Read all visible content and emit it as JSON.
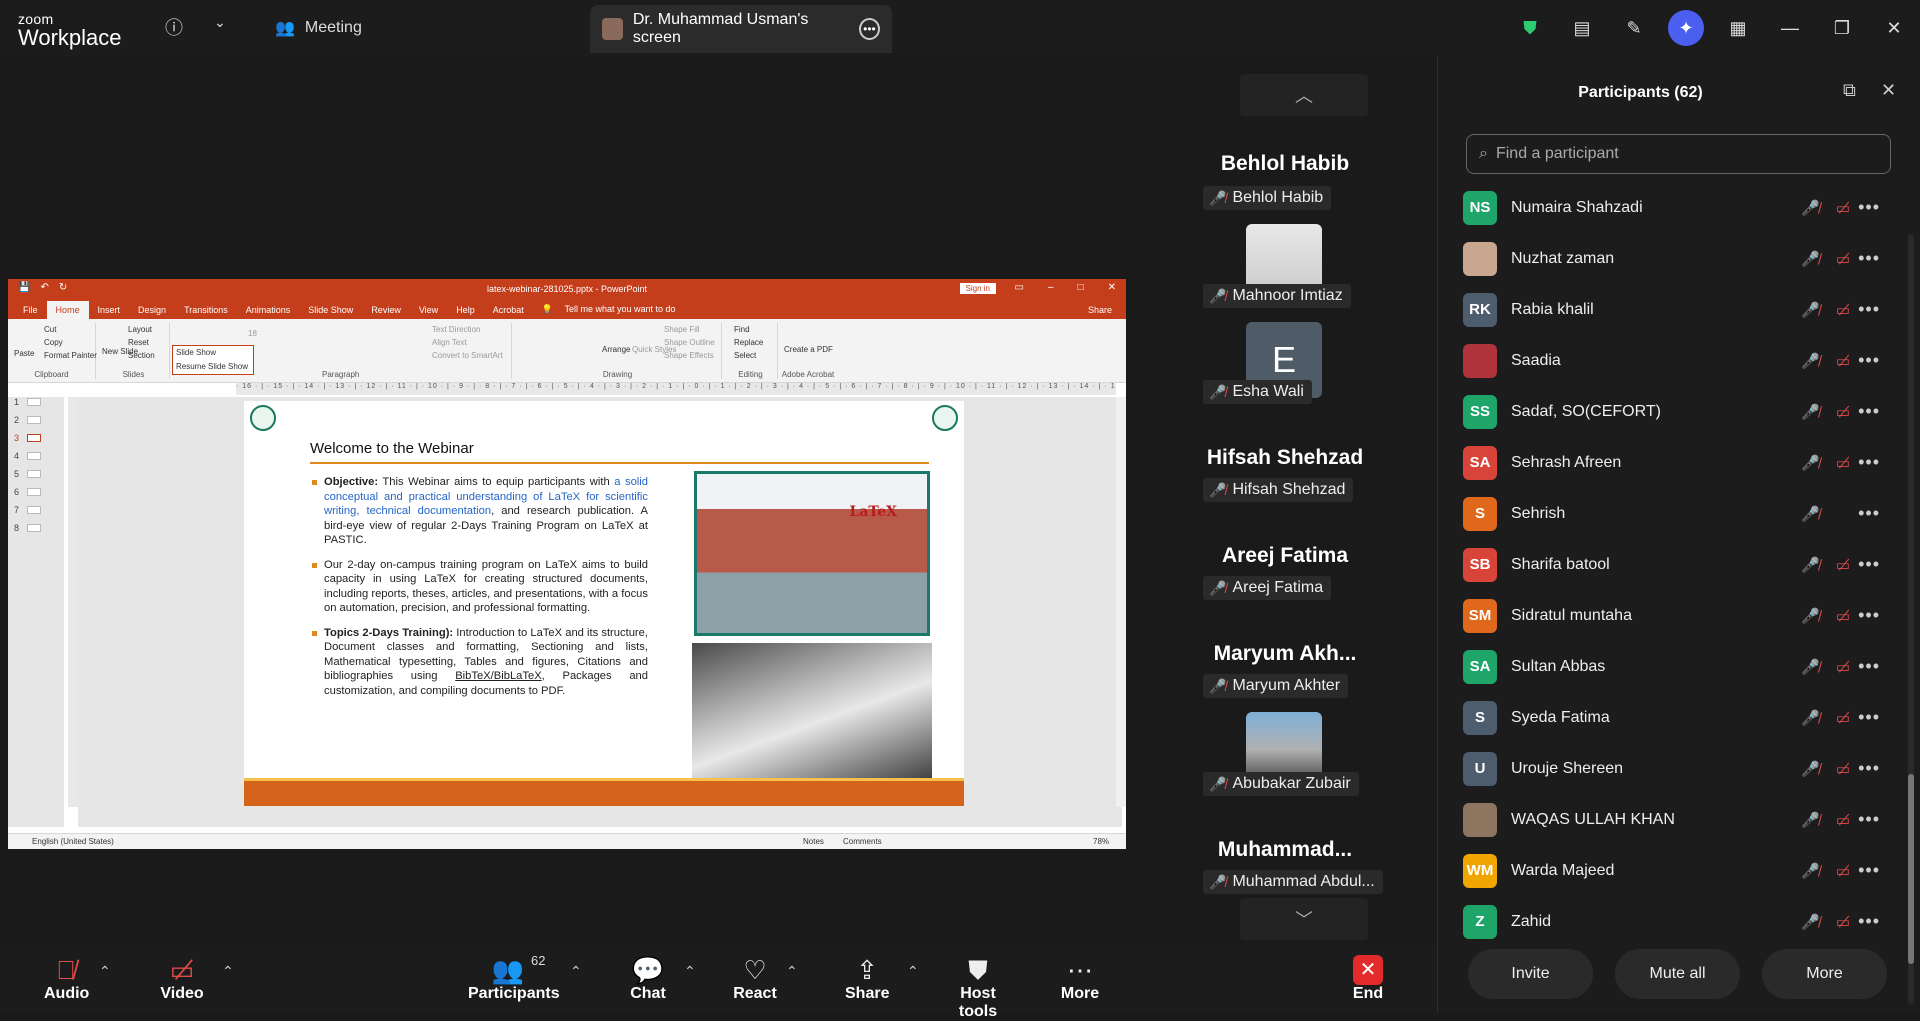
{
  "app": {
    "brand_top": "zoom",
    "brand_bottom": "Workplace",
    "meeting_label": "Meeting",
    "screen_tab": "Dr. Muhammad Usman's screen"
  },
  "ppt": {
    "title": "latex-webinar-281025.pptx - PowerPoint",
    "sign_in": "Sign in",
    "tabs": [
      "File",
      "Home",
      "Insert",
      "Design",
      "Transitions",
      "Animations",
      "Slide Show",
      "Review",
      "View",
      "Help",
      "Acrobat"
    ],
    "tell_me": "Tell me what you want to do",
    "share": "Share",
    "ribbon": {
      "paste": "Paste",
      "cut": "Cut",
      "copy": "Copy",
      "format_painter": "Format Painter",
      "clipboard": "Clipboard",
      "new_slide": "New Slide",
      "layout": "Layout",
      "reset": "Reset",
      "section": "Section",
      "slides": "Slides",
      "slide_show": "Slide Show",
      "resume": "Resume Slide Show",
      "font_size": "18",
      "paragraph": "Paragraph",
      "text_direction": "Text Direction",
      "align_text": "Align Text",
      "convert": "Convert to SmartArt",
      "arrange": "Arrange",
      "quick_styles": "Quick Styles",
      "shape_fill": "Shape Fill",
      "shape_outline": "Shape Outline",
      "shape_effects": "Shape Effects",
      "drawing": "Drawing",
      "find": "Find",
      "replace": "Replace",
      "select": "Select",
      "editing": "Editing",
      "create_pdf": "Create a PDF",
      "adobe": "Adobe Acrobat"
    },
    "ruler": "· 16 · | · 15 · | · 14 · | · 13 · | · 12 · | · 11 · | · 10 · | · 9 · | · 8 · | · 7 · | · 6 · | · 5 · | · 4 · | · 3 · | · 2 · | · 1 · | · 0 · | · 1 · | · 2 · | · 3 · | · 4 · | · 5 · | · 6 · | · 7 · | · 8 · | · 9 · | · 10 · | · 11 · | · 12 · | · 13 · | · 14 · | · 15 · | · 16",
    "thumbs": [
      "1",
      "2",
      "3",
      "4",
      "5",
      "6",
      "7",
      "8"
    ],
    "slide": {
      "title": "Welcome to the Webinar",
      "b1_bold": "Objective:",
      "b1_a": " This Webinar aims to equip participants with ",
      "b1_link": "a solid conceptual and practical understanding of LaTeX for scientific writing, technical documentation",
      "b1_b": ", and research publication. A bird-eye view of regular 2-Days Training Program on LaTeX at PASTIC.",
      "b2": "Our 2-day on-campus training program on LaTeX aims to build capacity in using LaTeX for creating structured documents, including reports, theses, articles, and presentations, with a focus on automation, precision, and professional formatting.",
      "b3_bold": "Topics 2-Days Training):",
      "b3_a": " Introduction to LaTeX and its structure, Document classes and formatting, Sectioning and lists, Mathematical typesetting, Tables and figures, Citations and bibliographies using ",
      "b3_u": "BibTeX/BibLaTeX",
      "b3_b": ", Packages and customization, and compiling documents to PDF.",
      "photo_text": "LaTeX"
    },
    "status": {
      "lang": "English (United States)",
      "notes": "Notes",
      "comments": "Comments",
      "zoom": "78%"
    }
  },
  "gallery": [
    {
      "big": "Behlol Habib",
      "tag": "Behlol Habib"
    },
    {
      "tag": "Mahnoor Imtiaz"
    },
    {
      "letter": "E",
      "tag": "Esha Wali"
    },
    {
      "big": "Hifsah Shehzad",
      "tag": "Hifsah Shehzad"
    },
    {
      "big": "Areej Fatima",
      "tag": "Areej Fatima"
    },
    {
      "big": "Maryum  Akh...",
      "tag": "Maryum Akhter"
    },
    {
      "tag": "Abubakar Zubair"
    },
    {
      "big": "Muhammad...",
      "tag": "Muhammad Abdul..."
    }
  ],
  "participants": {
    "title": "Participants (62)",
    "search_placeholder": "Find a participant",
    "list": [
      {
        "initials": "NS",
        "name": "Numaira Shahzadi",
        "color": "#1fa46a",
        "video": true
      },
      {
        "initials": "",
        "name": "Nuzhat zaman",
        "color": "#c9a78f",
        "video": true
      },
      {
        "initials": "RK",
        "name": "Rabia khalil",
        "color": "#4d5d6e",
        "video": true
      },
      {
        "initials": "",
        "name": "Saadia",
        "color": "#b0323a",
        "video": true
      },
      {
        "initials": "SS",
        "name": "Sadaf, SO(CEFORT)",
        "color": "#1fa46a",
        "video": true
      },
      {
        "initials": "SA",
        "name": "Sehrash Afreen",
        "color": "#d9443a",
        "video": true
      },
      {
        "initials": "S",
        "name": "Sehrish",
        "color": "#e0681c",
        "video": false
      },
      {
        "initials": "SB",
        "name": "Sharifa batool",
        "color": "#d9443a",
        "video": true
      },
      {
        "initials": "SM",
        "name": "Sidratul muntaha",
        "color": "#e0681c",
        "video": true
      },
      {
        "initials": "SA",
        "name": "Sultan Abbas",
        "color": "#1fa46a",
        "video": true
      },
      {
        "initials": "S",
        "name": "Syeda Fatima",
        "color": "#4d5d6e",
        "video": true
      },
      {
        "initials": "U",
        "name": "Urouje Shereen",
        "color": "#4d5d6e",
        "video": true
      },
      {
        "initials": "",
        "name": "WAQAS ULLAH KHAN",
        "color": "#8d7560",
        "video": true
      },
      {
        "initials": "WM",
        "name": "Warda Majeed",
        "color": "#f0a500",
        "video": true
      },
      {
        "initials": "Z",
        "name": "Zahid",
        "color": "#1fa46a",
        "video": true
      }
    ],
    "invite": "Invite",
    "mute_all": "Mute all",
    "more": "More"
  },
  "toolbar": {
    "audio": "Audio",
    "video": "Video",
    "participants": "Participants",
    "count": "62",
    "chat": "Chat",
    "react": "React",
    "share": "Share",
    "host_tools": "Host tools",
    "more": "More",
    "end": "End"
  }
}
